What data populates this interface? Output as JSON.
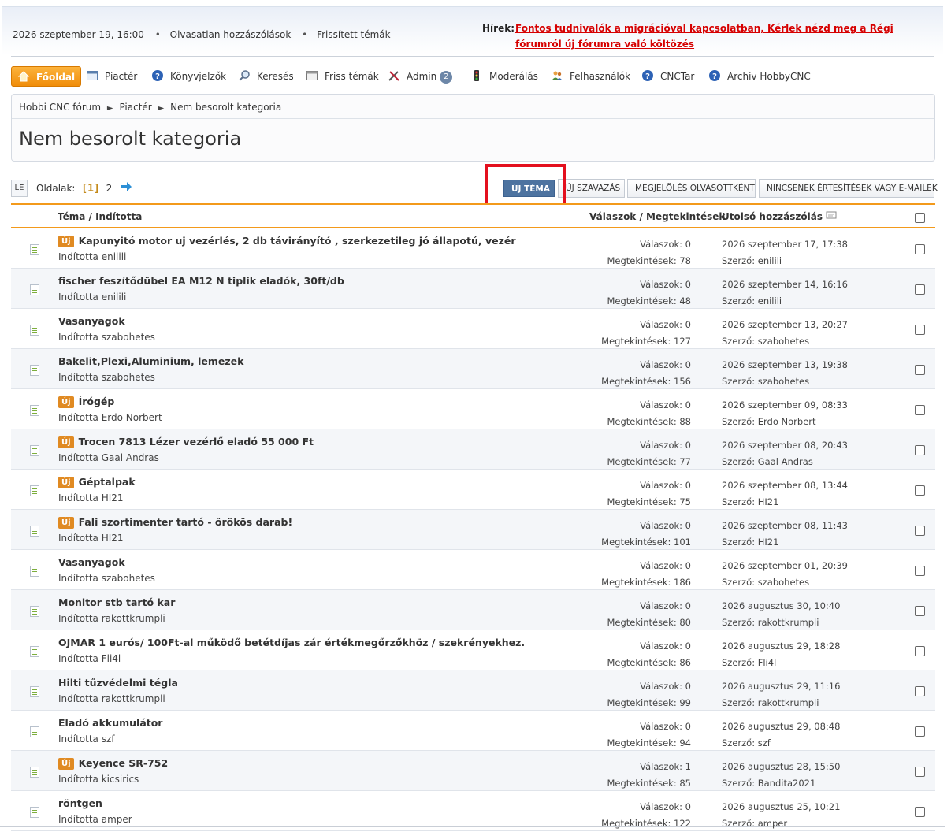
{
  "header": {
    "datetime": "2026 szeptember 19, 16:00",
    "links": [
      "Olvasatlan hozzászólások",
      "Frissített témák"
    ],
    "news_label": "Hírek:",
    "news_text": "Fontos tudnivalók a migrációval kapcsolatban, Kérlek nézd meg a Régi fórumról új fórumra való költözés"
  },
  "menu": [
    {
      "label": "Főoldal",
      "icon": "home-icon",
      "active": true
    },
    {
      "label": "Piactér",
      "icon": "calendar-icon"
    },
    {
      "label": "Könyvjelzők",
      "icon": "help-icon"
    },
    {
      "label": "Keresés",
      "icon": "search-icon"
    },
    {
      "label": "Friss témák",
      "icon": "calendar-icon"
    },
    {
      "label": "Admin",
      "icon": "tools-icon",
      "badge": "2"
    },
    {
      "label": "Moderálás",
      "icon": "traffic-light-icon"
    },
    {
      "label": "Felhasználók",
      "icon": "users-icon"
    },
    {
      "label": "CNCTar",
      "icon": "help-icon"
    },
    {
      "label": "Archiv HobbyCNC",
      "icon": "help-icon"
    }
  ],
  "breadcrumb": [
    "Hobbi CNC fórum",
    "Piactér",
    "Nem besorolt kategoria"
  ],
  "page_title": "Nem besorolt kategoria",
  "pager": {
    "le": "LE",
    "label": "Oldalak:",
    "current": "[1]",
    "next_page": "2"
  },
  "buttons": {
    "new_topic": "Új téma",
    "new_poll": "Új szavazás",
    "mark_read": "Megjelölés olvasottként",
    "notify": "Nincsenek értesítések vagy e-mailek"
  },
  "table_headers": {
    "topic": "Téma / Indította",
    "stats": "Válaszok / Megtekintések",
    "last_post": "Utolsó hozzászólás"
  },
  "topics": [
    {
      "new": true,
      "title": "Kapunyitó motor uj vezérlés, 2 db távirányító , szerkezetileg jó állapotú, vezér",
      "starter": "Indította enilili",
      "replies": "Válaszok: 0",
      "views": "Megtekintések: 78",
      "last_date": "2026 szeptember 17, 17:38",
      "last_author": "Szerző: enilili"
    },
    {
      "new": false,
      "title": "fischer feszítődübel EA M12 N tiplik eladók, 30ft/db",
      "starter": "Indította enilili",
      "replies": "Válaszok: 0",
      "views": "Megtekintések: 48",
      "last_date": "2026 szeptember 14, 16:16",
      "last_author": "Szerző: enilili"
    },
    {
      "new": false,
      "title": "Vasanyagok",
      "starter": "Indította szabohetes",
      "replies": "Válaszok: 0",
      "views": "Megtekintések: 127",
      "last_date": "2026 szeptember 13, 20:27",
      "last_author": "Szerző: szabohetes"
    },
    {
      "new": false,
      "title": "Bakelit,Plexi,Aluminium, lemezek",
      "starter": "Indította szabohetes",
      "replies": "Válaszok: 0",
      "views": "Megtekintések: 156",
      "last_date": "2026 szeptember 13, 19:38",
      "last_author": "Szerző: szabohetes"
    },
    {
      "new": true,
      "title": "Írógép",
      "starter": "Indította Erdo Norbert",
      "replies": "Válaszok: 0",
      "views": "Megtekintések: 88",
      "last_date": "2026 szeptember 09, 08:33",
      "last_author": "Szerző: Erdo Norbert"
    },
    {
      "new": true,
      "title": "Trocen 7813 Lézer vezérlő eladó 55 000 Ft",
      "starter": "Indította Gaal Andras",
      "replies": "Válaszok: 0",
      "views": "Megtekintések: 77",
      "last_date": "2026 szeptember 08, 20:43",
      "last_author": "Szerző: Gaal Andras"
    },
    {
      "new": true,
      "title": "Géptalpak",
      "starter": "Indította HI21",
      "replies": "Válaszok: 0",
      "views": "Megtekintések: 75",
      "last_date": "2026 szeptember 08, 13:44",
      "last_author": "Szerző: HI21"
    },
    {
      "new": true,
      "title": "Fali szortimenter tartó - örökös darab!",
      "starter": "Indította HI21",
      "replies": "Válaszok: 0",
      "views": "Megtekintések: 101",
      "last_date": "2026 szeptember 08, 11:43",
      "last_author": "Szerző: HI21"
    },
    {
      "new": false,
      "title": "Vasanyagok",
      "starter": "Indította szabohetes",
      "replies": "Válaszok: 0",
      "views": "Megtekintések: 186",
      "last_date": "2026 szeptember 01, 20:39",
      "last_author": "Szerző: szabohetes"
    },
    {
      "new": false,
      "title": "Monitor stb tartó kar",
      "starter": "Indította rakottkrumpli",
      "replies": "Válaszok: 0",
      "views": "Megtekintések: 80",
      "last_date": "2026 augusztus 30, 10:40",
      "last_author": "Szerző: rakottkrumpli"
    },
    {
      "new": false,
      "title": "OJMAR 1 eurós/ 100Ft-al működő betétdíjas zár értékmegőrzőkhöz / szekrényekhez.",
      "starter": "Indította Fli4l",
      "replies": "Válaszok: 0",
      "views": "Megtekintések: 86",
      "last_date": "2026 augusztus 29, 18:28",
      "last_author": "Szerző: Fli4l"
    },
    {
      "new": false,
      "title": "Hilti tűzvédelmi tégla",
      "starter": "Indította rakottkrumpli",
      "replies": "Válaszok: 0",
      "views": "Megtekintések: 99",
      "last_date": "2026 augusztus 29, 11:16",
      "last_author": "Szerző: rakottkrumpli"
    },
    {
      "new": false,
      "title": "Eladó akkumulátor",
      "starter": "Indította szf",
      "replies": "Válaszok: 0",
      "views": "Megtekintések: 94",
      "last_date": "2026 augusztus 29, 08:48",
      "last_author": "Szerző: szf"
    },
    {
      "new": true,
      "title": "Keyence SR-752",
      "starter": "Indította kicsirics",
      "replies": "Válaszok: 1",
      "views": "Megtekintések: 85",
      "last_date": "2026 augusztus 28, 15:50",
      "last_author": "Szerző: Bandita2021"
    },
    {
      "new": false,
      "title": "röntgen",
      "starter": "Indította amper",
      "replies": "Válaszok: 0",
      "views": "Megtekintések: 122",
      "last_date": "2026 augusztus 25, 10:21",
      "last_author": "Szerző: amper"
    }
  ],
  "new_badge": "Új",
  "colors": {
    "accent": "#f39a1b",
    "primary_button": "#4d73a0",
    "news": "#d60000",
    "highlight": "#e3101e"
  }
}
